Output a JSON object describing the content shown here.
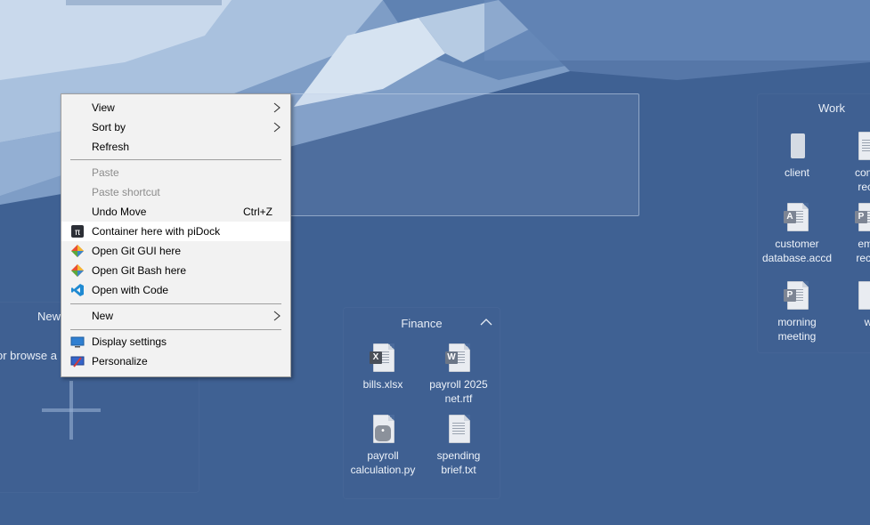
{
  "menu": {
    "items": [
      {
        "label": "View",
        "submenu": true
      },
      {
        "label": "Sort by",
        "submenu": true
      },
      {
        "label": "Refresh"
      },
      {
        "label": "Paste",
        "disabled": true
      },
      {
        "label": "Paste shortcut",
        "disabled": true
      },
      {
        "label": "Undo Move",
        "shortcut": "Ctrl+Z"
      },
      {
        "label": "Container here with piDock",
        "icon": "pidock-icon"
      },
      {
        "label": "Open Git GUI here",
        "icon": "git-icon"
      },
      {
        "label": "Open Git Bash here",
        "icon": "git-icon"
      },
      {
        "label": "Open with Code",
        "icon": "vscode-icon"
      },
      {
        "label": "New",
        "submenu": true
      },
      {
        "label": "Display settings",
        "icon": "display-icon"
      },
      {
        "label": "Personalize",
        "icon": "personalize-icon"
      }
    ]
  },
  "fences": {
    "finance": {
      "title": "Finance",
      "items": [
        {
          "label": "bills.xlsx",
          "icon": "excel-icon"
        },
        {
          "label": "payroll 2025 net.rtf",
          "icon": "word-icon"
        },
        {
          "label": "payroll calculation.py",
          "icon": "python-icon"
        },
        {
          "label": "spending brief.txt",
          "icon": "text-icon"
        }
      ]
    },
    "work": {
      "title": "Work",
      "items": [
        {
          "label": "client",
          "icon": "folder-icon"
        },
        {
          "label": "comm reco",
          "icon": "document-icon"
        },
        {
          "label": "customer database.accd",
          "icon": "access-icon"
        },
        {
          "label": "emp recor",
          "icon": "powerpoint-icon"
        },
        {
          "label": "morning meeting",
          "icon": "powerpoint-icon"
        },
        {
          "label": "w",
          "icon": "document-icon"
        }
      ]
    },
    "new": {
      "title": "New",
      "hint": "or browse a"
    }
  },
  "colors": {
    "desktop": "#3f6193",
    "menu_bg": "#f2f2f2",
    "menu_hover": "#ffffff",
    "disabled_text": "#8c8c8c"
  }
}
